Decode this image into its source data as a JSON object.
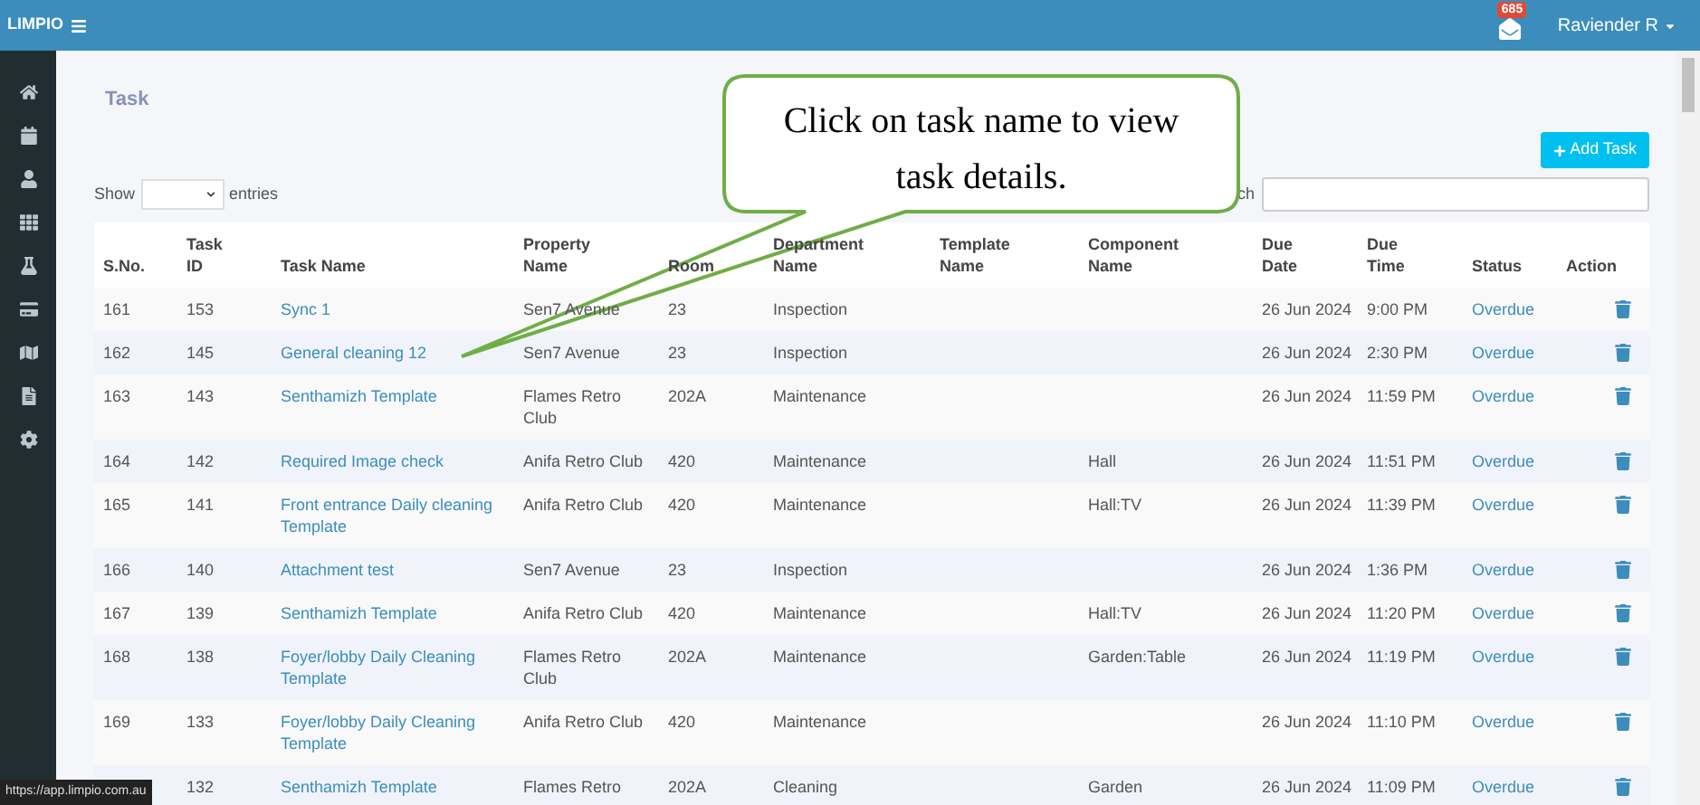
{
  "topbar": {
    "brand": "LIMPIO",
    "badge": "685",
    "user": "Raviender R"
  },
  "sidebar": {
    "items": [
      {
        "kind": "home"
      },
      {
        "kind": "calendar"
      },
      {
        "kind": "user"
      },
      {
        "kind": "grid"
      },
      {
        "kind": "flask"
      },
      {
        "kind": "card"
      },
      {
        "kind": "map"
      },
      {
        "kind": "file"
      },
      {
        "kind": "gear"
      }
    ]
  },
  "page": {
    "title": "Task",
    "add_button": "Add Task",
    "show_label": "Show",
    "entries_label": "entries",
    "search_label": "ch"
  },
  "table": {
    "columns": [
      [
        "S.No."
      ],
      [
        "Task",
        "ID"
      ],
      [
        "Task Name"
      ],
      [
        "Property",
        "Name"
      ],
      [
        "Room"
      ],
      [
        "Department",
        "Name"
      ],
      [
        "Template",
        "Name"
      ],
      [
        "Component",
        "Name"
      ],
      [
        "Due",
        "Date"
      ],
      [
        "Due",
        "Time"
      ],
      [
        "Status"
      ],
      [
        "Action"
      ]
    ],
    "rows": [
      {
        "s_no": "161",
        "task_id": "153",
        "task_name": "Sync 1",
        "property": "Sen7 Avenue",
        "room": "23",
        "department": "Inspection",
        "component": "",
        "due_date": "26 Jun 2024",
        "due_time": "9:00 PM",
        "status": "Overdue"
      },
      {
        "s_no": "162",
        "task_id": "145",
        "task_name": "General cleaning 12",
        "property": "Sen7 Avenue",
        "room": "23",
        "department": "Inspection",
        "component": "",
        "due_date": "26 Jun 2024",
        "due_time": "2:30 PM",
        "status": "Overdue"
      },
      {
        "s_no": "163",
        "task_id": "143",
        "task_name": "Senthamizh Template",
        "property": "Flames Retro Club",
        "room": "202A",
        "department": "Maintenance",
        "component": "",
        "due_date": "26 Jun 2024",
        "due_time": "11:59 PM",
        "status": "Overdue"
      },
      {
        "s_no": "164",
        "task_id": "142",
        "task_name": "Required Image check",
        "property": "Anifa Retro Club",
        "room": "420",
        "department": "Maintenance",
        "component": "Hall",
        "due_date": "26 Jun 2024",
        "due_time": "11:51 PM",
        "status": "Overdue"
      },
      {
        "s_no": "165",
        "task_id": "141",
        "task_name": "Front entrance Daily cleaning Template",
        "property": "Anifa Retro Club",
        "room": "420",
        "department": "Maintenance",
        "component": "Hall:TV",
        "due_date": "26 Jun 2024",
        "due_time": "11:39 PM",
        "status": "Overdue"
      },
      {
        "s_no": "166",
        "task_id": "140",
        "task_name": "Attachment test",
        "property": "Sen7 Avenue",
        "room": "23",
        "department": "Inspection",
        "component": "",
        "due_date": "26 Jun 2024",
        "due_time": "1:36 PM",
        "status": "Overdue"
      },
      {
        "s_no": "167",
        "task_id": "139",
        "task_name": "Senthamizh Template",
        "property": "Anifa Retro Club",
        "room": "420",
        "department": "Maintenance",
        "component": "Hall:TV",
        "due_date": "26 Jun 2024",
        "due_time": "11:20 PM",
        "status": "Overdue"
      },
      {
        "s_no": "168",
        "task_id": "138",
        "task_name": "Foyer/lobby Daily Cleaning Template",
        "property": "Flames Retro Club",
        "room": "202A",
        "department": "Maintenance",
        "component": "Garden:Table",
        "due_date": "26 Jun 2024",
        "due_time": "11:19 PM",
        "status": "Overdue"
      },
      {
        "s_no": "169",
        "task_id": "133",
        "task_name": "Foyer/lobby Daily Cleaning Template",
        "property": "Anifa Retro Club",
        "room": "420",
        "department": "Maintenance",
        "component": "",
        "due_date": "26 Jun 2024",
        "due_time": "11:10 PM",
        "status": "Overdue"
      },
      {
        "task_id": "132",
        "task_name": "Senthamizh Template",
        "property": "Flames Retro",
        "room": "202A",
        "department": "Cleaning",
        "component": "Garden",
        "due_date": "26 Jun 2024",
        "due_time": "11:09 PM",
        "status": "Overdue"
      }
    ]
  },
  "callout": {
    "text": "Click on task name to view task details."
  },
  "status_url": "https://app.limpio.com.au"
}
